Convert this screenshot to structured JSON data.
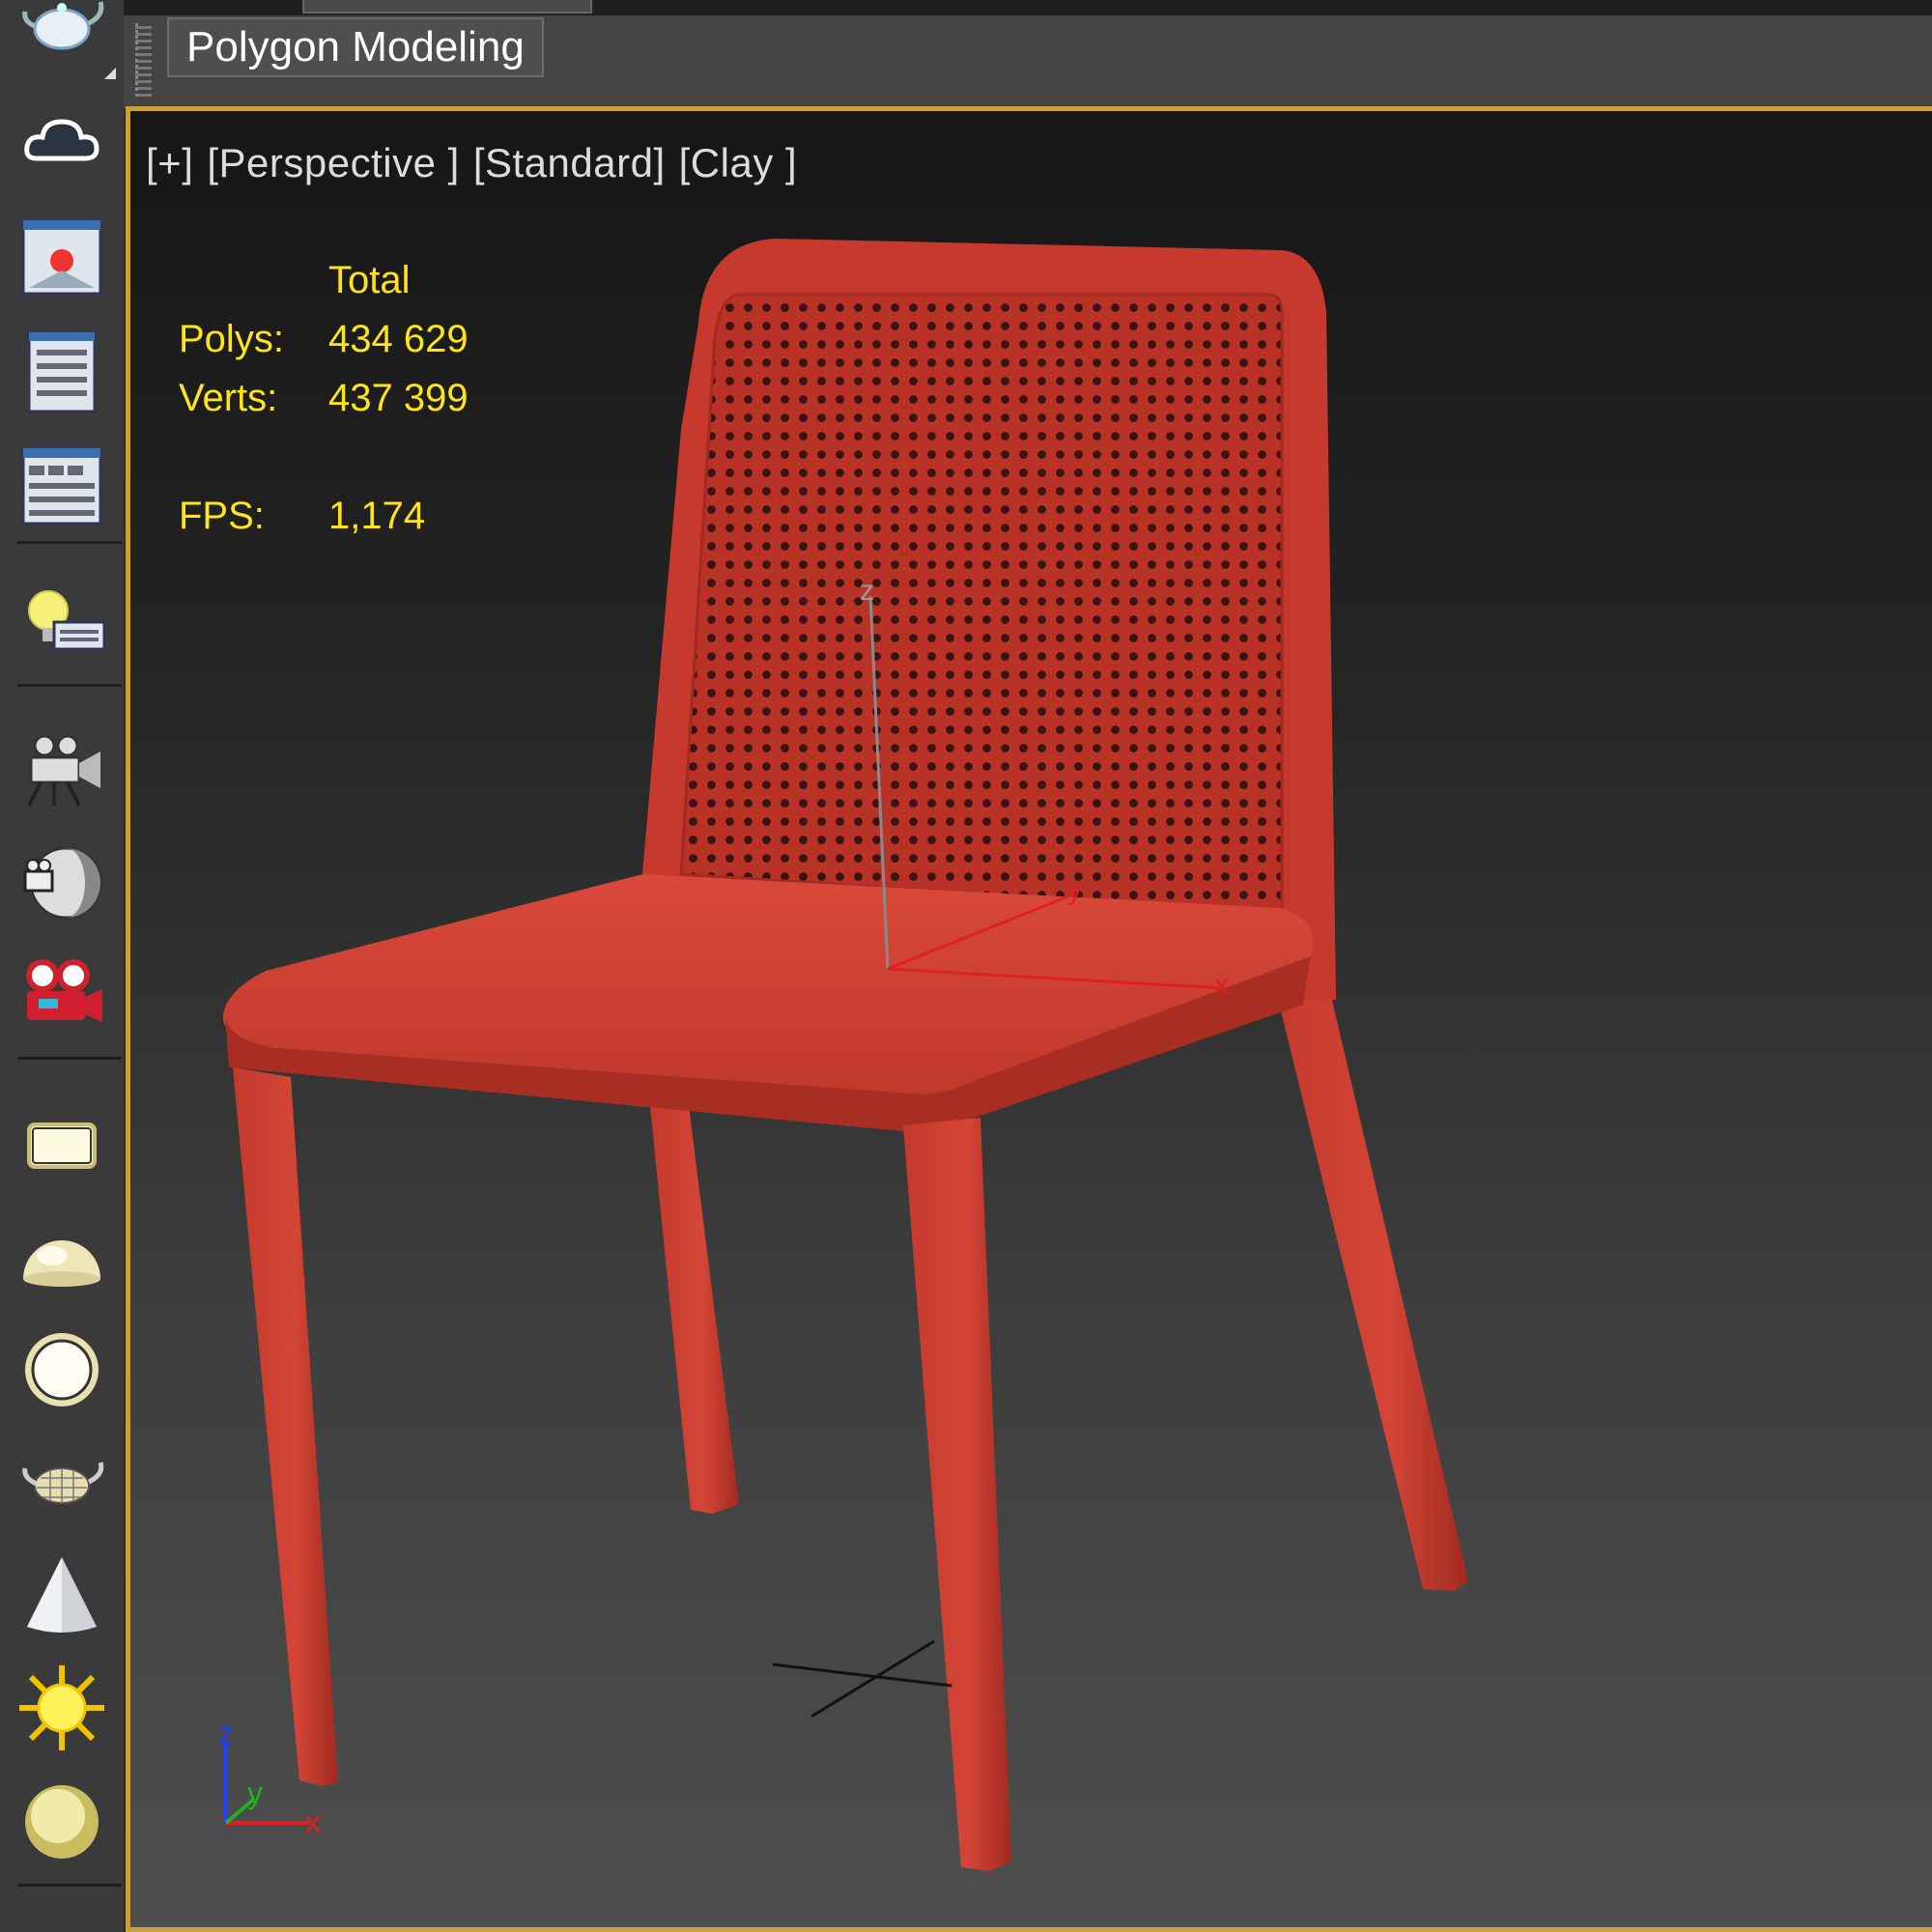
{
  "ribbon": {
    "active_tab": "Polygon Modeling"
  },
  "viewport": {
    "labels": [
      "[+]",
      "[Perspective ]",
      "[Standard]",
      "[Clay ]"
    ],
    "stats": {
      "header": "Total",
      "rows": [
        {
          "key": "Polys:",
          "value": "434 629"
        },
        {
          "key": "Verts:",
          "value": "437 399"
        },
        {
          "key": "FPS:",
          "value": "1,174"
        }
      ]
    },
    "gizmo_axes": {
      "x": "x",
      "y": "y",
      "z": "z"
    },
    "object_axes": {
      "x": "x",
      "y": "y",
      "z": "z"
    }
  },
  "toolbar": {
    "icons": [
      "teapot-icon",
      "cloud-icon",
      "render-window-icon",
      "render-setup-icon",
      "material-editor-icon",
      "light-lister-icon",
      "camera-icon",
      "camera-sphere-icon",
      "video-camera-icon",
      "plane-icon",
      "hemisphere-icon",
      "sphere-icon",
      "wire-teapot-icon",
      "cone-icon",
      "sun-icon",
      "sky-sphere-icon"
    ]
  },
  "colors": {
    "viewport_border": "#c9a03b",
    "stats_text": "#ffe419",
    "chair": "#c53a2e",
    "axis_x": "#e02020",
    "axis_y": "#22b022",
    "axis_z": "#2040ff"
  }
}
